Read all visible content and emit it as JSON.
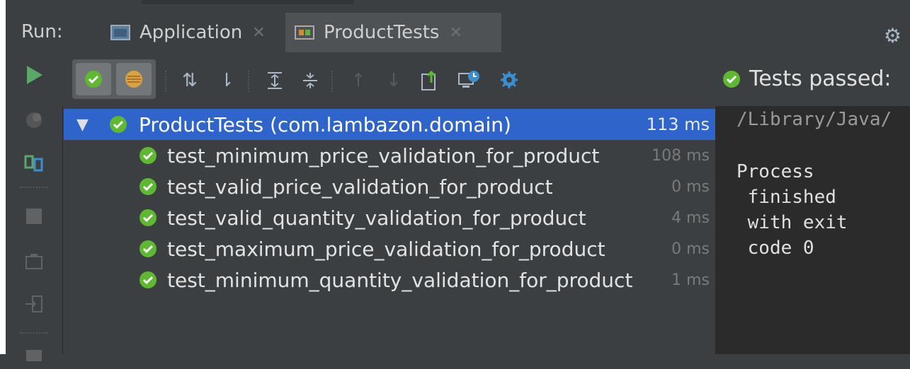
{
  "run_panel": {
    "label": "Run:",
    "tabs": [
      {
        "label": "Application",
        "icon": "application-icon"
      },
      {
        "label": "ProductTests",
        "icon": "test-config-icon"
      }
    ]
  },
  "status": {
    "text": "Tests passed:"
  },
  "tree": {
    "root": {
      "name": "ProductTests (com.lambazon.domain)",
      "time": "113 ms"
    },
    "tests": [
      {
        "name": "test_minimum_price_validation_for_product",
        "time": "108 ms"
      },
      {
        "name": "test_valid_price_validation_for_product",
        "time": "0 ms"
      },
      {
        "name": "test_valid_quantity_validation_for_product",
        "time": "4 ms"
      },
      {
        "name": "test_maximum_price_validation_for_product",
        "time": "0 ms"
      },
      {
        "name": "test_minimum_quantity_validation_for_product",
        "time": "1 ms"
      }
    ]
  },
  "console": {
    "path": "/Library/Java/",
    "lines": [
      "Process",
      " finished",
      " with exit",
      " code 0"
    ]
  },
  "colors": {
    "accent": "#2f65ca",
    "pass_green": "#5fb832",
    "run_green": "#59a869"
  }
}
